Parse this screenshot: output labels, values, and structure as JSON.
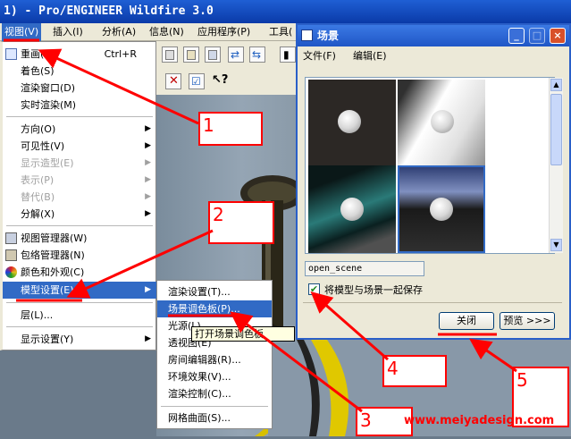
{
  "app": {
    "title": "1) - Pro/ENGINEER Wildfire 3.0"
  },
  "menubar": {
    "items": [
      {
        "label": "视图(V)"
      },
      {
        "label": "插入(I)"
      },
      {
        "label": "分析(A)"
      },
      {
        "label": "信息(N)"
      },
      {
        "label": "应用程序(P)"
      },
      {
        "label": "工具("
      }
    ]
  },
  "view_menu": {
    "items": [
      {
        "label": "重画(R)",
        "shortcut": "Ctrl+R"
      },
      {
        "label": "着色(S)"
      },
      {
        "label": "渲染窗口(D)"
      },
      {
        "label": "实时渲染(M)"
      },
      {
        "label": "方向(O)"
      },
      {
        "label": "可见性(V)"
      },
      {
        "label": "显示造型(E)"
      },
      {
        "label": "表示(P)"
      },
      {
        "label": "替代(B)"
      },
      {
        "label": "分解(X)"
      },
      {
        "label": "视图管理器(W)"
      },
      {
        "label": "包络管理器(N)"
      },
      {
        "label": "颜色和外观(C)"
      },
      {
        "label": "模型设置(E)"
      },
      {
        "label": "层(L)..."
      },
      {
        "label": "显示设置(Y)"
      }
    ]
  },
  "model_settings_submenu": {
    "items": [
      {
        "label": "渲染设置(T)..."
      },
      {
        "label": "场景调色板(P)..."
      },
      {
        "label": "光源(L)..."
      },
      {
        "label": "透视图(E)"
      },
      {
        "label": "房间编辑器(R)..."
      },
      {
        "label": "环境效果(V)..."
      },
      {
        "label": "渲染控制(C)..."
      },
      {
        "label": "网格曲面(S)..."
      }
    ]
  },
  "tooltip": "打开场景调色板",
  "scene_dialog": {
    "title": "场景",
    "menu": [
      {
        "label": "文件(F)"
      },
      {
        "label": "编辑(E)"
      }
    ],
    "window_buttons": {
      "minimize": "_",
      "maximize": "□",
      "close": "×"
    },
    "scene_name": "open_scene",
    "save_with_model_label": "将模型与场景一起保存",
    "save_with_model_checked": true,
    "close_button": "关闭",
    "preview_button": "预览 >>>"
  },
  "annotations": {
    "labels": [
      "1",
      "2",
      "3",
      "4",
      "5"
    ],
    "color": "#ff0000"
  },
  "watermark": "www.meiyadesign.com"
}
